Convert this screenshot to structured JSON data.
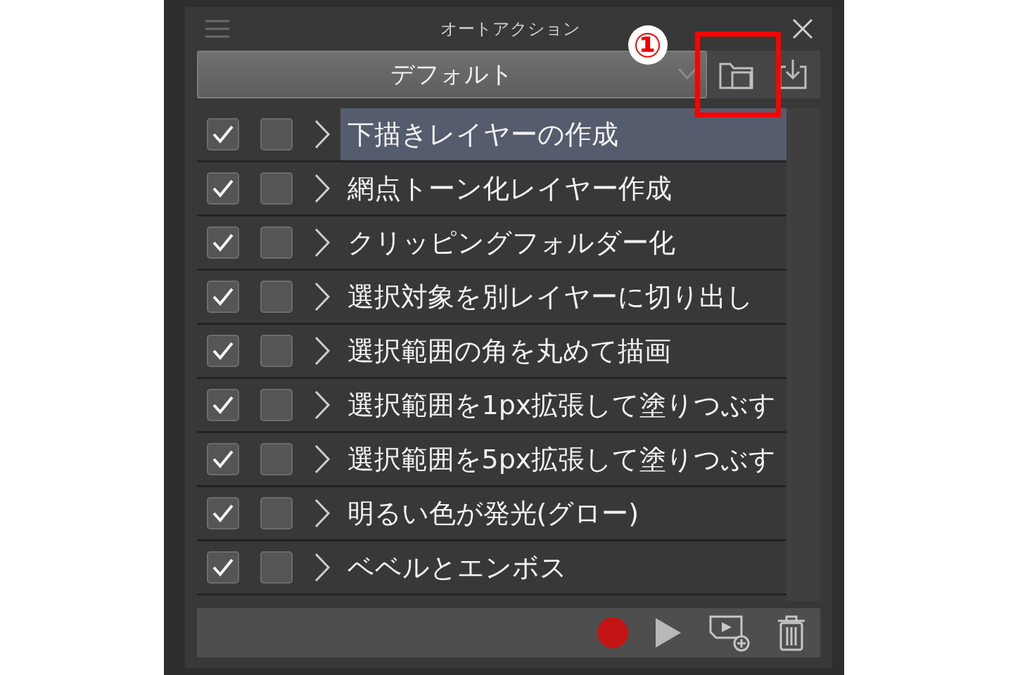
{
  "panel": {
    "title": "オートアクション",
    "set": {
      "value": "デフォルト"
    }
  },
  "actions": [
    {
      "label": "下描きレイヤーの作成",
      "checked": true,
      "dialog": false,
      "selected": true
    },
    {
      "label": "網点トーン化レイヤー作成",
      "checked": true,
      "dialog": false,
      "selected": false
    },
    {
      "label": "クリッピングフォルダー化",
      "checked": true,
      "dialog": false,
      "selected": false
    },
    {
      "label": "選択対象を別レイヤーに切り出し",
      "checked": true,
      "dialog": false,
      "selected": false
    },
    {
      "label": "選択範囲の角を丸めて描画",
      "checked": true,
      "dialog": false,
      "selected": false
    },
    {
      "label": "選択範囲を1px拡張して塗りつぶす",
      "checked": true,
      "dialog": false,
      "selected": false
    },
    {
      "label": "選択範囲を5px拡張して塗りつぶす",
      "checked": true,
      "dialog": false,
      "selected": false
    },
    {
      "label": "明るい色が発光(グロー)",
      "checked": true,
      "dialog": false,
      "selected": false
    },
    {
      "label": "ベベルとエンボス",
      "checked": true,
      "dialog": false,
      "selected": false
    }
  ],
  "annotation": {
    "label": "①"
  }
}
